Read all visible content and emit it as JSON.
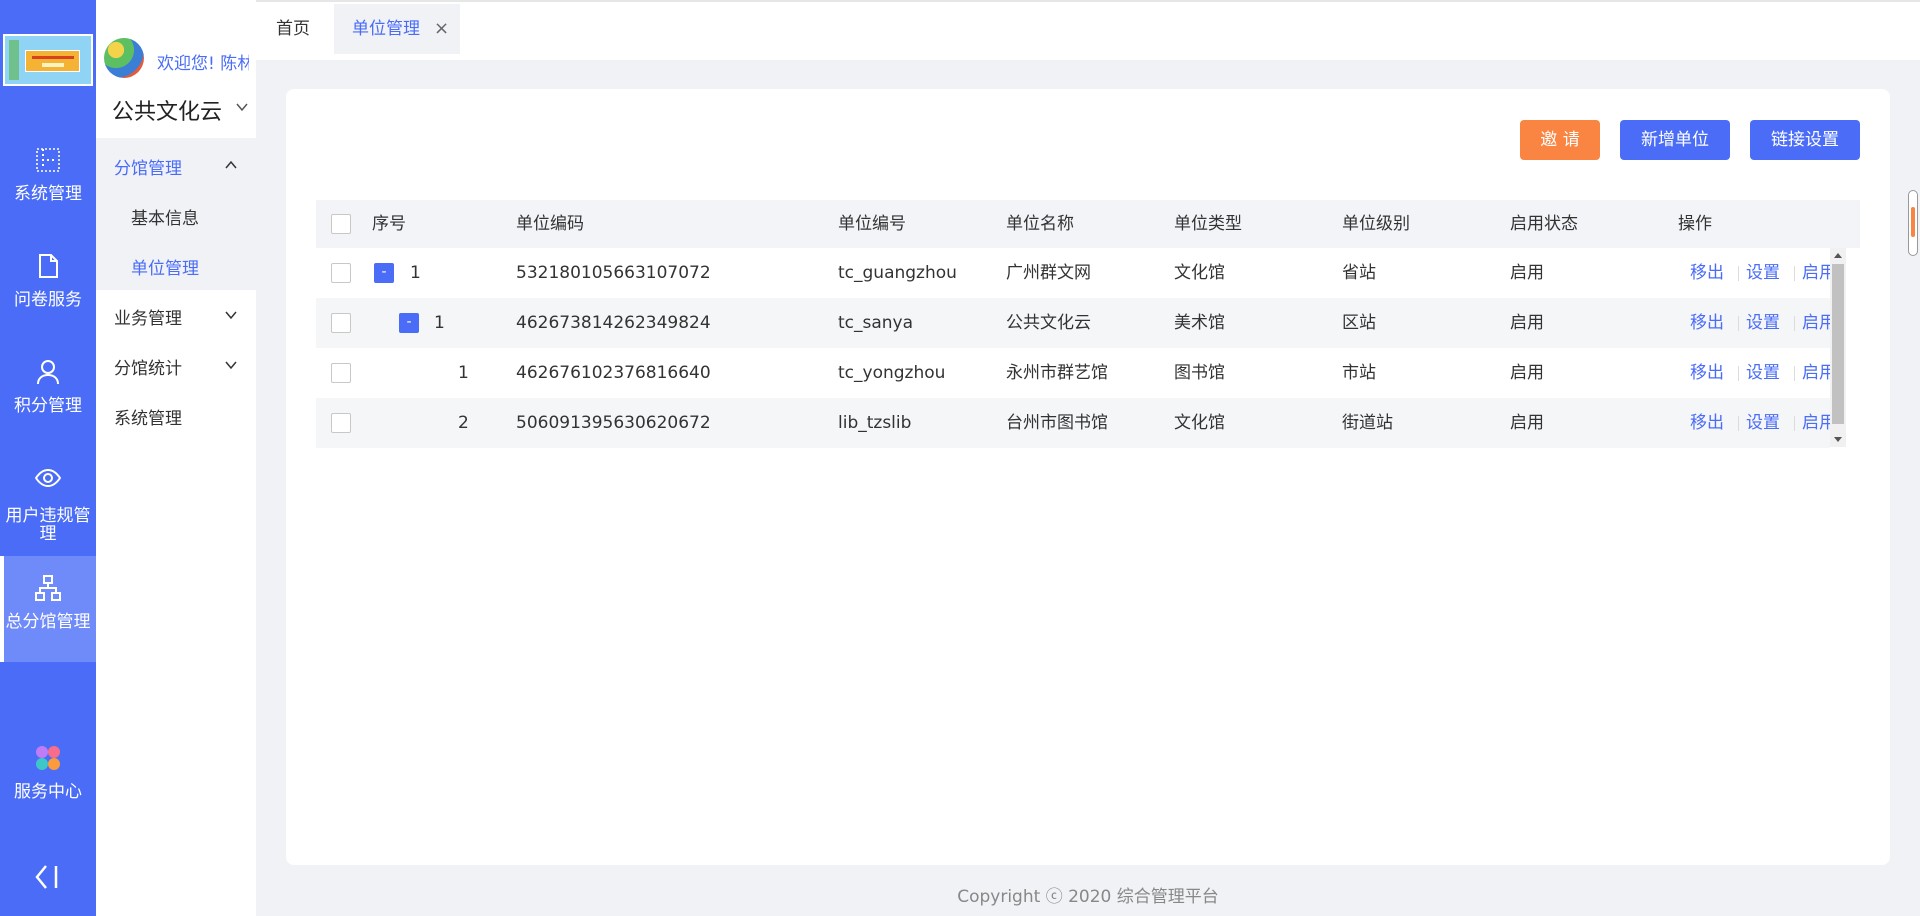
{
  "rail": {
    "items": [
      {
        "label": "系统管理",
        "icon": "grid-icon"
      },
      {
        "label": "问卷服务",
        "icon": "document-icon"
      },
      {
        "label": "积分管理",
        "icon": "user-icon"
      },
      {
        "label": "用户违规管",
        "label2": "理",
        "icon": "eye-icon"
      },
      {
        "label": "总分馆管理",
        "icon": "org-chart-icon"
      },
      {
        "label": "服务中心",
        "icon": "petals-icon"
      }
    ]
  },
  "sidebar": {
    "welcome": "欢迎您!  陈林",
    "org": "公共文化云",
    "menu": {
      "branch": "分馆管理",
      "basic_info": "基本信息",
      "unit_mgmt": "单位管理",
      "business": "业务管理",
      "stats": "分馆统计",
      "system": "系统管理"
    }
  },
  "tabs": {
    "home": "首页",
    "active": "单位管理",
    "close": "×"
  },
  "buttons": {
    "invite": "邀 请",
    "new_unit": "新增单位",
    "link_settings": "链接设置"
  },
  "table": {
    "headers": [
      "序号",
      "单位编码",
      "单位编号",
      "单位名称",
      "单位类型",
      "单位级别",
      "启用状态",
      "操作"
    ],
    "rows": [
      {
        "seq": "1",
        "code": "532180105663107072",
        "number": "tc_guangzhou",
        "name": "广州群文网",
        "type": "文化馆",
        "level": "省站",
        "status": "启用"
      },
      {
        "seq": "1",
        "code": "462673814262349824",
        "number": "tc_sanya",
        "name": "公共文化云",
        "type": "美术馆",
        "level": "区站",
        "status": "启用"
      },
      {
        "seq": "1",
        "code": "462676102376816640",
        "number": "tc_yongzhou",
        "name": "永州市群艺馆",
        "type": "图书馆",
        "level": "市站",
        "status": "启用"
      },
      {
        "seq": "2",
        "code": "506091395630620672",
        "number": "lib_tzslib",
        "name": "台州市图书馆",
        "type": "文化馆",
        "level": "街道站",
        "status": "启用"
      }
    ],
    "ops": {
      "move_out": "移出",
      "settings": "设置",
      "enable": "启用"
    },
    "expand_symbol": "-"
  },
  "footer": "Copyright ⓒ 2020 综合管理平台",
  "colors": {
    "primary": "#4a6cf7",
    "accent_orange": "#fa8442"
  }
}
